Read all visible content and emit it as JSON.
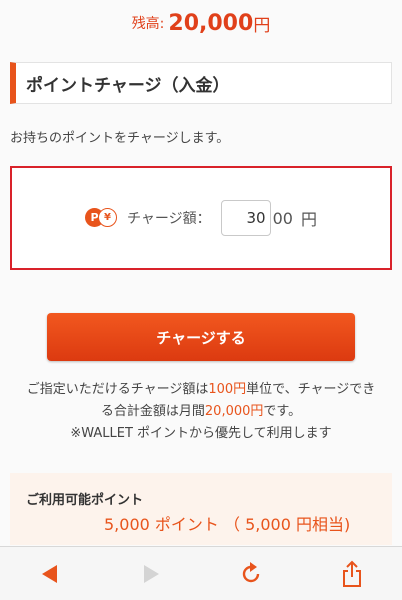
{
  "balance": {
    "label": "残高:",
    "amount": "20,000",
    "unit": "円"
  },
  "section": {
    "title": "ポイントチャージ（入金）"
  },
  "intro": "お持ちのポイントをチャージします。",
  "charge": {
    "label": "チャージ額：",
    "input_value": "30",
    "suffix": "00",
    "unit": "円"
  },
  "button": {
    "label": "チャージする"
  },
  "notes": {
    "line1_a": "ご指定いただけるチャージ額は",
    "line1_b": "100円",
    "line1_c": "単位で、チャージでき",
    "line2_a": "る合計金額は月間",
    "line2_b": "20,000円",
    "line2_c": "です。",
    "line3": "※WALLET ポイントから優先して利用します"
  },
  "points": {
    "title": "ご利用可能ポイント",
    "value": "5,000 ポイント （ 5,000 円相当)"
  },
  "colors": {
    "accent": "#e8541c",
    "highlight_border": "#d9222a"
  },
  "toolbar_icons": [
    "back-arrow-icon",
    "forward-arrow-icon",
    "reload-icon",
    "share-icon"
  ]
}
